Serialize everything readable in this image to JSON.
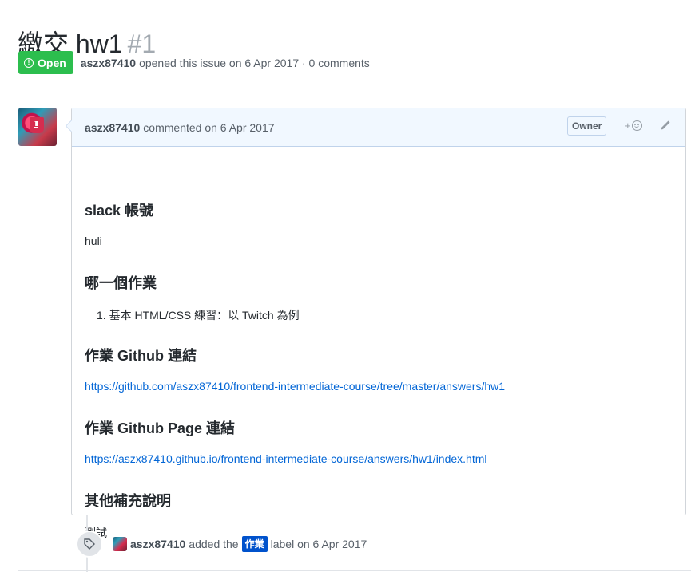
{
  "issue": {
    "title": "繳交 hw1",
    "number": "#1",
    "state": "Open",
    "author": "aszx87410",
    "opened_text": "opened this issue on 6 Apr 2017 · 0 comments",
    "state_color": "#2cbe4e"
  },
  "comment": {
    "author": "aszx87410",
    "commented_text": "commented on 6 Apr 2017",
    "owner_badge": "Owner",
    "reaction_plus": "+",
    "icons": [
      "smiley-icon",
      "pencil-icon"
    ],
    "body": {
      "h_slack": "slack 帳號",
      "slack_value": "huli",
      "h_which": "哪一個作業",
      "list_item_1_num": "1.",
      "list_item_1": "基本 HTML/CSS 練習：以 Twitch 為例",
      "h_github": "作業 Github 連結",
      "github_link": "https://github.com/aszx87410/frontend-intermediate-course/tree/master/answers/hw1",
      "h_page": "作業 Github Page 連結",
      "page_link": "https://aszx87410.github.io/frontend-intermediate-course/answers/hw1/index.html",
      "h_other": "其他補充說明",
      "other_value": "測試"
    }
  },
  "event": {
    "author": "aszx87410",
    "added_text": "added the",
    "label": "作業",
    "label_color": "#0052cc",
    "after_text": "label on 6 Apr 2017",
    "icon": "tag-icon"
  },
  "colors": {
    "link": "#0366d6",
    "header_bg": "#f1f8ff"
  }
}
